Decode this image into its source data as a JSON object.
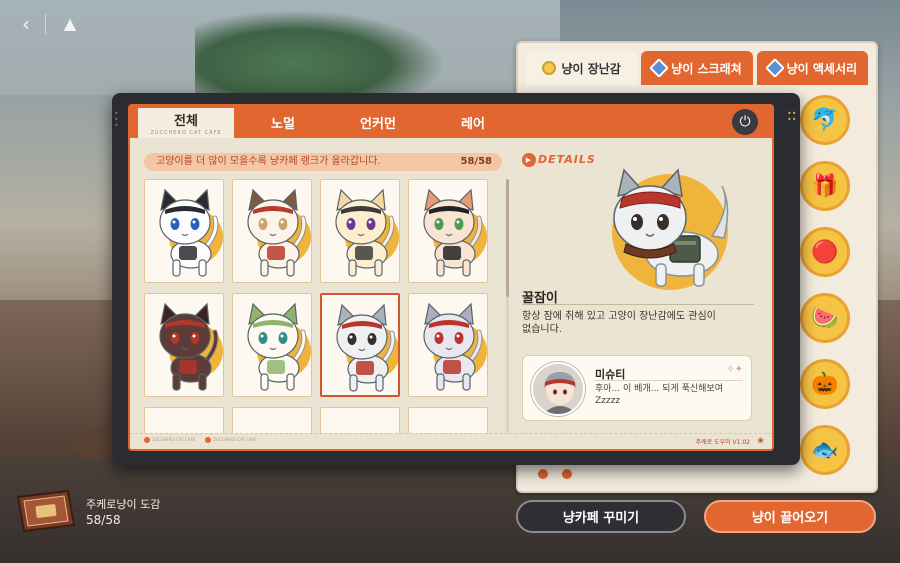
{
  "nav": {
    "back_icon": "‹",
    "home_icon": "▲"
  },
  "side_panel": {
    "tabs": [
      {
        "label": "냥이 장난감",
        "active": true
      },
      {
        "label": "냥이 스크래쳐",
        "active": false
      },
      {
        "label": "냥이 액세서리",
        "active": false
      }
    ],
    "items": [
      {
        "icon": "dolphin-toy",
        "glyph": "🐬"
      },
      {
        "icon": "box-toy",
        "glyph": "🎁"
      },
      {
        "icon": "ball-toy",
        "glyph": "🔴"
      },
      {
        "icon": "melon-toy",
        "glyph": "🍉"
      },
      {
        "icon": "pumpkin-toy",
        "glyph": "🎃"
      },
      {
        "icon": "fish-toy",
        "glyph": "🐟"
      }
    ]
  },
  "modal": {
    "tabs": [
      {
        "label": "전체",
        "sub": "ZUCCHERO CAT CAFE",
        "active": true
      },
      {
        "label": "노멀",
        "active": false
      },
      {
        "label": "언커먼",
        "active": false
      },
      {
        "label": "레어",
        "active": false
      }
    ],
    "power_icon": "⏻",
    "rank_text": "고양이를 더 많이 모을수록 냥카페 랭크가 올라갑니다.",
    "rank_count": "58/58",
    "cards": [
      {
        "id": "cat-1",
        "fur": "#fdfdfd",
        "ear": "#2a2a30",
        "eye": "#2b5fb8",
        "accent": "#2a2a30",
        "selected": false
      },
      {
        "id": "cat-2",
        "fur": "#fcf4e8",
        "ear": "#7b5a43",
        "eye": "#c9a36b",
        "accent": "#b73a2d",
        "selected": false
      },
      {
        "id": "cat-3",
        "fur": "#fcefcf",
        "ear": "#f4d9a8",
        "eye": "#6b3a8e",
        "accent": "#3b3b3b",
        "selected": false
      },
      {
        "id": "cat-4",
        "fur": "#f9e3d2",
        "ear": "#e89a74",
        "eye": "#4a9a52",
        "accent": "#222",
        "selected": false
      },
      {
        "id": "cat-5",
        "fur": "#5c3b38",
        "ear": "#3b2422",
        "eye": "#b3362b",
        "accent": "#b3362b",
        "selected": false
      },
      {
        "id": "cat-6",
        "fur": "#fdfaf2",
        "ear": "#8fb56c",
        "eye": "#2f8e8a",
        "accent": "#8fb56c",
        "selected": false
      },
      {
        "id": "cat-7",
        "fur": "#eef0f1",
        "ear": "#aab3b8",
        "eye": "#3a2f28",
        "accent": "#b8362c",
        "selected": true
      },
      {
        "id": "cat-8",
        "fur": "#e8e6ee",
        "ear": "#b0acc0",
        "eye": "#b8362c",
        "accent": "#b8362c",
        "selected": false
      }
    ],
    "detail": {
      "logo": "DETAILS",
      "name": "꿀잠이",
      "description": "항상 잠에 취해 있고 고양이 장난감에도 관심이 없습니다.",
      "comment": {
        "name": "미슈티",
        "text": "후아... 이 베개... 되게 푹신해보여Zzzzz",
        "spark": "✧✦"
      }
    },
    "footer": {
      "left": [
        "ZUCCHERO CAT CAFE",
        "ZUCCHERO CAT CAFE"
      ],
      "version": "주케로 도우미 V1.02",
      "paw": "❀"
    }
  },
  "book": {
    "title": "주케로냥이 도감",
    "count": "58/58"
  },
  "buttons": {
    "decorate": "냥카페 꾸미기",
    "call": "냥이 끌어오기"
  }
}
